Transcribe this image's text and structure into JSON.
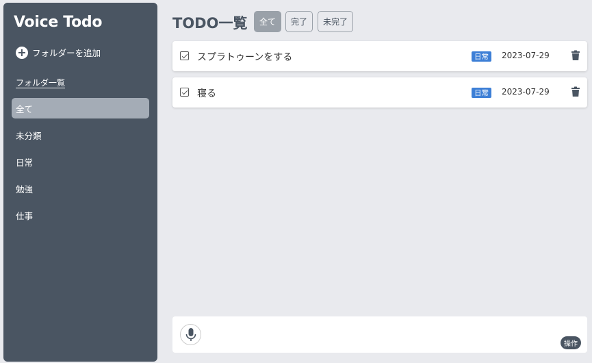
{
  "sidebar": {
    "app_title": "Voice Todo",
    "add_folder_label": "フォルダーを追加",
    "folder_list_label": "フォルダ一覧",
    "folders": [
      {
        "label": "全て",
        "active": true
      },
      {
        "label": "未分類",
        "active": false
      },
      {
        "label": "日常",
        "active": false
      },
      {
        "label": "勉強",
        "active": false
      },
      {
        "label": "仕事",
        "active": false
      }
    ]
  },
  "main": {
    "title": "TODO一覧",
    "filters": [
      {
        "label": "全て",
        "active": true
      },
      {
        "label": "完了",
        "active": false
      },
      {
        "label": "未完了",
        "active": false
      }
    ],
    "todos": [
      {
        "text": "スプラトゥーンをする",
        "tag": "日常",
        "date": "2023-07-29",
        "checked": true
      },
      {
        "text": "寝る",
        "tag": "日常",
        "date": "2023-07-29",
        "checked": true
      }
    ]
  },
  "voice_bar": {
    "ops_label": "操作",
    "mic_icon": "microphone-icon"
  },
  "colors": {
    "sidebar_bg": "#4a5562",
    "page_bg": "#e9eaee",
    "tag_blue": "#3d7fd6",
    "active_filter": "#9aa1a9"
  }
}
